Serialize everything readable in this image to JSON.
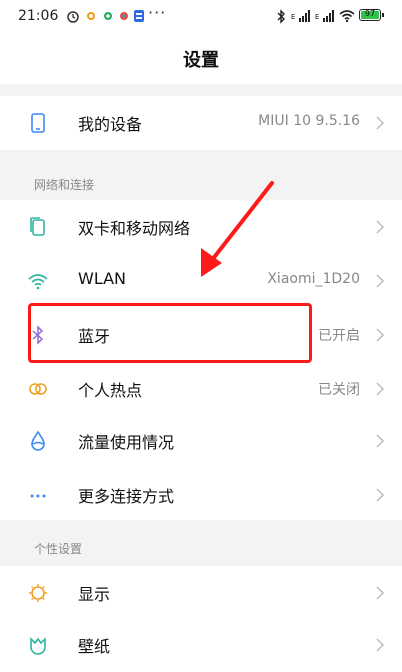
{
  "status_bar": {
    "time": "21:06",
    "more": "···",
    "battery": "97"
  },
  "header": {
    "title": "设置"
  },
  "sections": {
    "network_label": "网络和连接",
    "personal_label": "个性设置"
  },
  "rows": {
    "my_device": {
      "label": "我的设备",
      "value": "MIUI 10 9.5.16"
    },
    "dual_sim": {
      "label": "双卡和移动网络",
      "value": ""
    },
    "wlan": {
      "label": "WLAN",
      "value": "Xiaomi_1D20"
    },
    "bluetooth": {
      "label": "蓝牙",
      "value": "已开启"
    },
    "hotspot": {
      "label": "个人热点",
      "value": "已关闭"
    },
    "data_usage": {
      "label": "流量使用情况",
      "value": ""
    },
    "more_connect": {
      "label": "更多连接方式",
      "value": ""
    },
    "display": {
      "label": "显示",
      "value": ""
    },
    "wallpaper": {
      "label": "壁纸",
      "value": ""
    }
  },
  "colors": {
    "accent_blue": "#3d8af7",
    "highlight_red": "#ff1a1a",
    "battery_green": "#2fc34a",
    "gray_text": "#888888"
  },
  "icons": {
    "my_device": "phone-icon",
    "dual_sim": "sim-cards-icon",
    "wlan": "wifi-icon",
    "bluetooth": "bluetooth-icon",
    "hotspot": "hotspot-icon",
    "data_usage": "data-drop-icon",
    "more_connect": "more-dots-icon",
    "display": "sun-icon",
    "wallpaper": "wallpaper-icon"
  }
}
